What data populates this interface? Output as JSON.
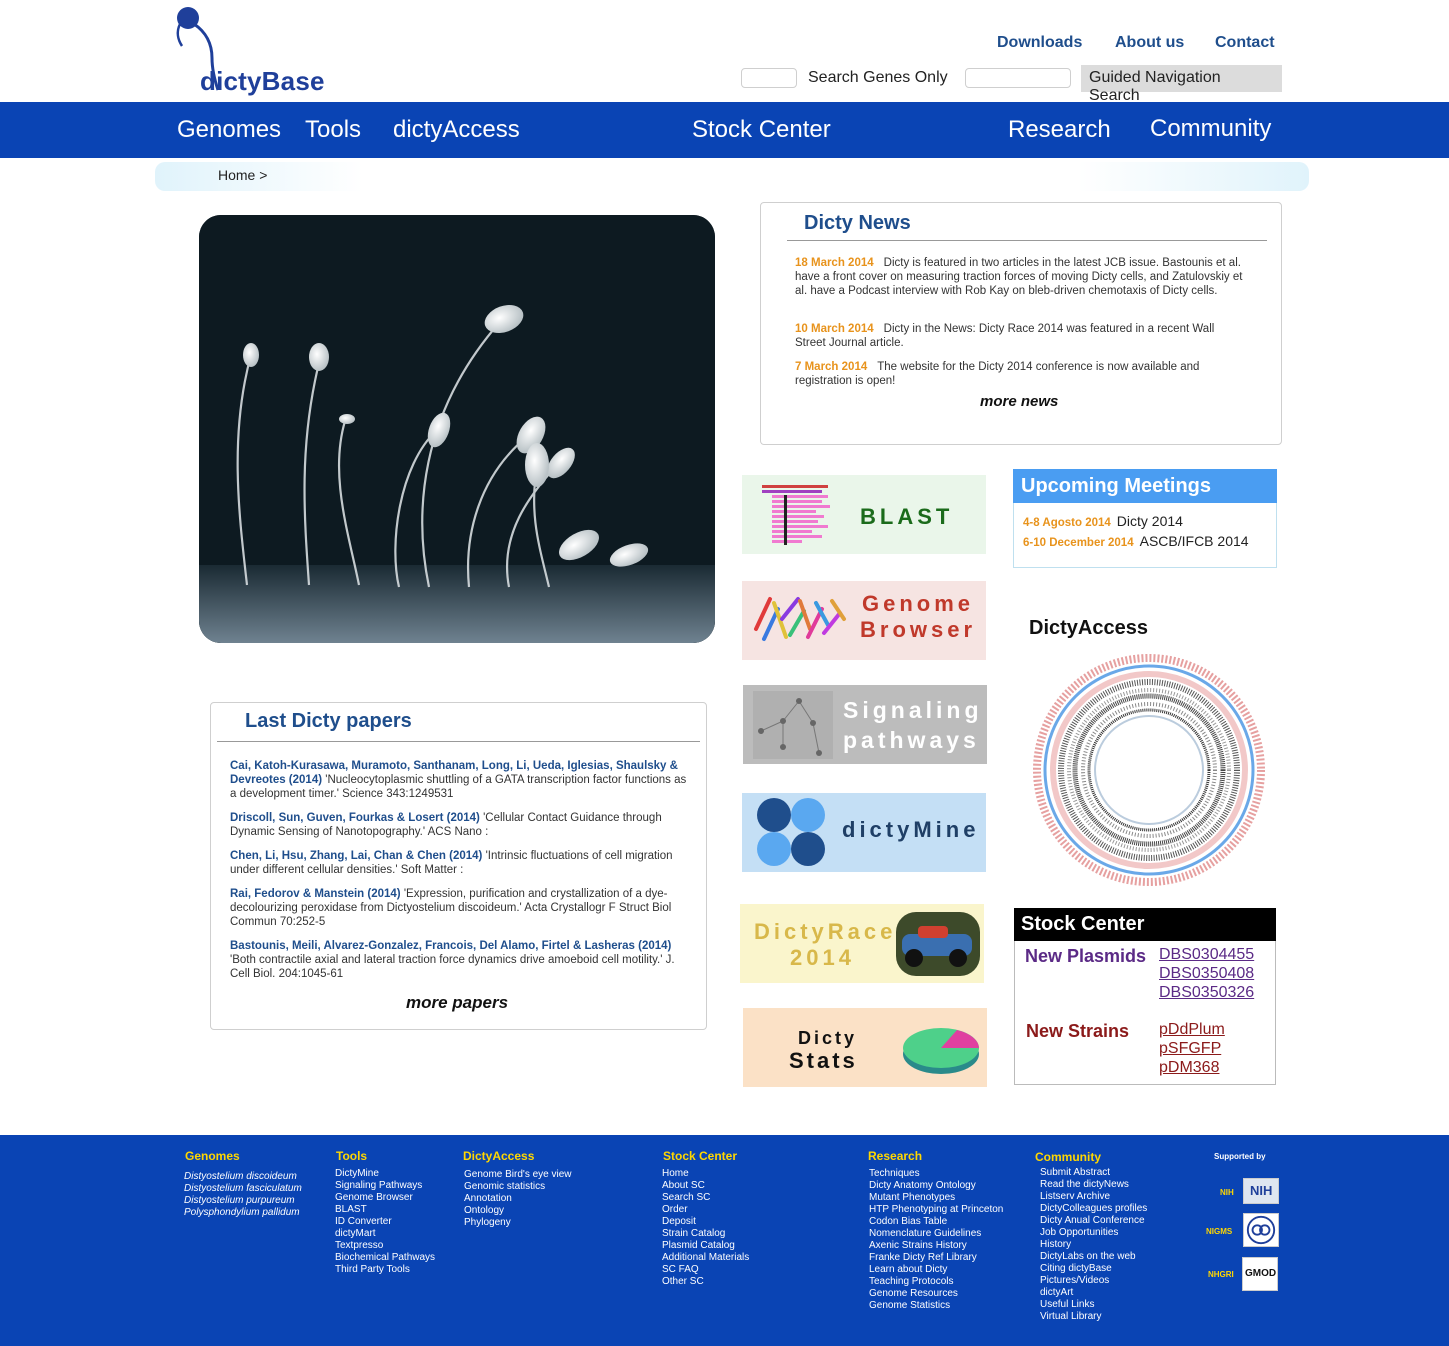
{
  "header": {
    "logo_text": "dictyBase",
    "links": [
      "Downloads",
      "About us",
      "Contact"
    ],
    "search_genes_label": "Search Genes Only",
    "guided_search_label": "Guided Navigation Search"
  },
  "nav": {
    "items": [
      "Genomes",
      "Tools",
      "dictyAccess",
      "Stock Center",
      "Research",
      "Community"
    ]
  },
  "breadcrumb": "Home >",
  "news": {
    "title": "Dicty News",
    "items": [
      {
        "date": "18 March 2014",
        "text": "Dicty is featured in two articles in the latest JCB issue. Bastounis et al. have a front cover on measuring traction forces of moving Dicty cells, and Zatulovskiy et al. have a Podcast interview with Rob Kay on bleb-driven chemotaxis of Dicty cells."
      },
      {
        "date": "10 March 2014",
        "text": "Dicty in the News: Dicty Race 2014 was featured in a recent Wall Street Journal article."
      },
      {
        "date": "7 March 2014",
        "text": "The website for the Dicty 2014 conference is now available and registration is open!"
      }
    ],
    "more": "more news"
  },
  "papers": {
    "title": "Last Dicty papers",
    "items": [
      {
        "authors": "Cai, Katoh-Kurasawa, Muramoto, Santhanam, Long, Li, Ueda, Iglesias, Shaulsky & Devreotes (2014)",
        "text": "'Nucleocytoplasmic shuttling of a GATA transcription factor functions as a development timer.' Science 343:1249531"
      },
      {
        "authors": "Driscoll, Sun, Guven, Fourkas & Losert (2014)",
        "text": "'Cellular Contact Guidance through Dynamic Sensing of Nanotopography.' ACS Nano :"
      },
      {
        "authors": "Chen, Li, Hsu, Zhang, Lai, Chan & Chen (2014)",
        "text": "'Intrinsic fluctuations of cell migration under different cellular densities.' Soft Matter :"
      },
      {
        "authors": "Rai, Fedorov & Manstein (2014)",
        "text": "'Expression, purification and crystallization of a dye-decolourizing peroxidase from Dictyostelium discoideum.' Acta Crystallogr F Struct Biol Commun 70:252-5"
      },
      {
        "authors": "Bastounis, Meili, Alvarez-Gonzalez, Francois, Del Alamo, Firtel & Lasheras (2014)",
        "text": "'Both contractile axial and lateral traction force dynamics drive amoeboid cell motility.' J. Cell Biol. 204:1045-61"
      }
    ],
    "more": "more papers"
  },
  "tiles": {
    "blast": {
      "line1": "BLAST",
      "line2": ""
    },
    "genome_browser": {
      "line1": "Genome",
      "line2": "Browser"
    },
    "signaling": {
      "line1": "Signaling",
      "line2": "pathways"
    },
    "dictymine": {
      "line1": "dictyMine",
      "line2": ""
    },
    "dictyrace": {
      "line1": "DictyRace",
      "line2": "2014"
    },
    "dictystats": {
      "line1": "Dicty",
      "line2": "Stats"
    }
  },
  "meetings": {
    "title": "Upcoming Meetings",
    "items": [
      {
        "date": "4-8 Agosto 2014",
        "name": "Dicty 2014"
      },
      {
        "date": "6-10 December 2014",
        "name": "ASCB/IFCB 2014"
      }
    ]
  },
  "dictyaccess": {
    "title": "DictyAccess"
  },
  "stock_center": {
    "title": "Stock Center",
    "plasmids_label": "New Plasmids",
    "plasmids": [
      "DBS0304455",
      "DBS0350408",
      "DBS0350326"
    ],
    "strains_label": "New Strains",
    "strains": [
      "pDdPlum",
      "pSFGFP",
      "pDM368"
    ]
  },
  "footer": {
    "columns": [
      {
        "title": "Genomes",
        "items": [
          "Distyostelium discoideum",
          "Distyostelium fasciculatum",
          "Distyostelium purpureum",
          "Polysphondylium pallidum"
        ]
      },
      {
        "title": "Tools",
        "items": [
          "DictyMine",
          "Signaling Pathways",
          "Genome Browser",
          "BLAST",
          "ID Converter",
          "dictyMart",
          "Textpresso",
          "Biochemical Pathways",
          "Third Party Tools"
        ]
      },
      {
        "title": "DictyAccess",
        "items": [
          "Genome Bird's eye view",
          "Genomic statistics",
          "Annotation",
          "Ontology",
          "Phylogeny"
        ]
      },
      {
        "title": "Stock Center",
        "items": [
          "Home",
          "About SC",
          "Search SC",
          "Order",
          "Deposit",
          "Strain Catalog",
          "Plasmid Catalog",
          "Additional Materials",
          "SC FAQ",
          "Other SC"
        ]
      },
      {
        "title": "Research",
        "items": [
          "Techniques",
          "Dicty Anatomy Ontology",
          "Mutant Phenotypes",
          "HTP Phenotyping at Princeton",
          "Codon Bias Table",
          "Nomenclature Guidelines",
          "Axenic Strains History",
          "Franke Dicty Ref Library",
          "Learn about Dicty",
          "Teaching Protocols",
          "Genome Resources",
          "Genome Statistics"
        ]
      },
      {
        "title": "Community",
        "items": [
          "Submit Abstract",
          "Read the dictyNews",
          "Listserv Archive",
          "DictyColleagues profiles",
          "Dicty Anual Conference",
          "Job Opportunities",
          "History",
          "DictyLabs on the web",
          "Citing dictyBase",
          "Pictures/Videos",
          "dictyArt",
          "Useful Links",
          "Virtual Library"
        ]
      }
    ],
    "supported_by": "Supported by",
    "supporters": [
      "NIH",
      "NIGMS",
      "NHGRI"
    ],
    "supporter_logos": [
      "NIH",
      "GMOD"
    ]
  },
  "colors": {
    "nav_blue": "#0a44b4",
    "title_blue": "#1f4e8c",
    "date_orange": "#e8931c",
    "footer_yellow": "#ffd700",
    "plasmid_purple": "#5b2a86",
    "strain_red": "#8b1a1a"
  }
}
